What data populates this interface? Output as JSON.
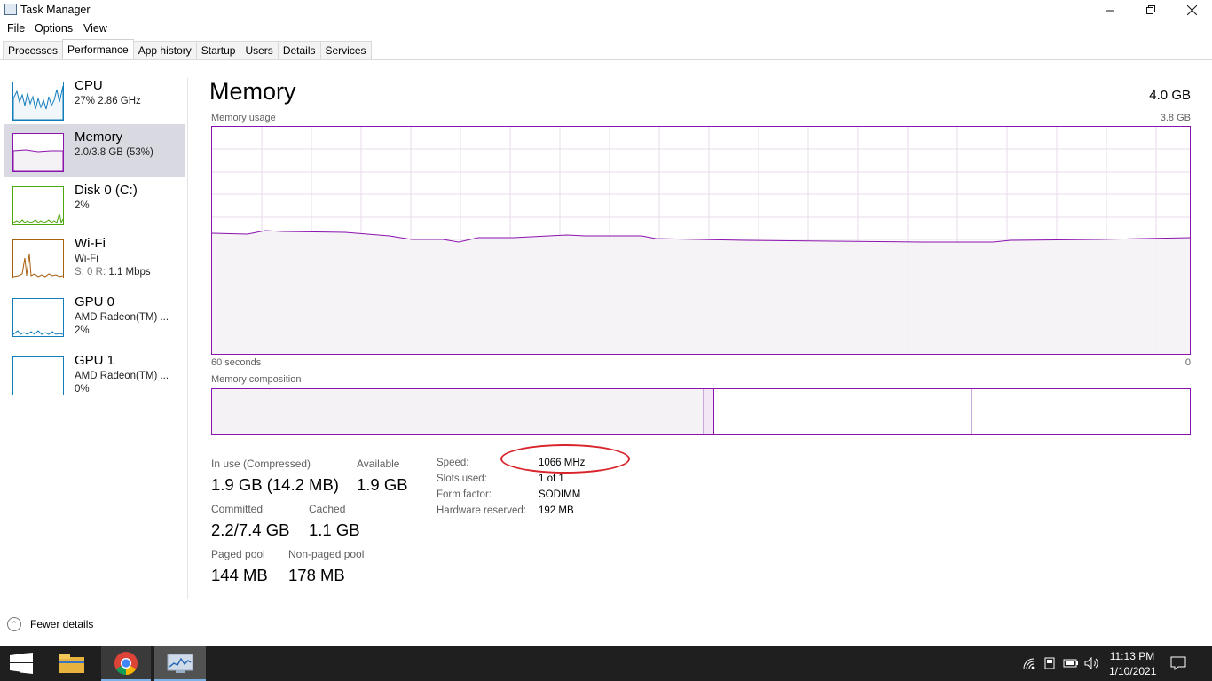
{
  "window": {
    "title": "Task Manager"
  },
  "menu": {
    "file": "File",
    "options": "Options",
    "view": "View"
  },
  "tabs": [
    {
      "label": "Processes"
    },
    {
      "label": "Performance"
    },
    {
      "label": "App history"
    },
    {
      "label": "Startup"
    },
    {
      "label": "Users"
    },
    {
      "label": "Details"
    },
    {
      "label": "Services"
    }
  ],
  "sidebar": {
    "cpu": {
      "title": "CPU",
      "sub": "27%  2.86 GHz",
      "color": "#117dbb"
    },
    "memory": {
      "title": "Memory",
      "sub": "2.0/3.8 GB (53%)",
      "color": "#8b12ae"
    },
    "disk": {
      "title": "Disk 0 (C:)",
      "sub": "2%",
      "color": "#4da60c"
    },
    "wifi": {
      "title": "Wi-Fi",
      "sub1": "Wi-Fi",
      "sub2_label": "S: 0 R: ",
      "sub2_value": "1.1 Mbps",
      "color": "#a75f10"
    },
    "gpu0": {
      "title": "GPU 0",
      "sub1": "AMD Radeon(TM) ...",
      "sub2": "2%",
      "color": "#117dbb"
    },
    "gpu1": {
      "title": "GPU 1",
      "sub1": "AMD Radeon(TM) ...",
      "sub2": "0%",
      "color": "#117dbb"
    }
  },
  "main": {
    "title": "Memory",
    "total": "4.0 GB",
    "usage_label": "Memory usage",
    "usage_max": "3.8 GB",
    "x_left": "60 seconds",
    "x_right": "0",
    "composition_label": "Memory composition"
  },
  "stats": {
    "in_use_label": "In use (Compressed)",
    "in_use_value": "1.9 GB (14.2 MB)",
    "available_label": "Available",
    "available_value": "1.9 GB",
    "committed_label": "Committed",
    "committed_value": "2.2/7.4 GB",
    "cached_label": "Cached",
    "cached_value": "1.1 GB",
    "paged_label": "Paged pool",
    "paged_value": "144 MB",
    "nonpaged_label": "Non-paged pool",
    "nonpaged_value": "178 MB"
  },
  "details": {
    "speed_label": "Speed:",
    "speed_value": "1066 MHz",
    "slots_label": "Slots used:",
    "slots_value": "1 of 1",
    "form_label": "Form factor:",
    "form_value": "SODIMM",
    "reserved_label": "Hardware reserved:",
    "reserved_value": "192 MB"
  },
  "footer": {
    "fewer_details": "Fewer details"
  },
  "taskbar": {
    "time": "11:13 PM",
    "date": "1/10/2021"
  },
  "colors": {
    "memory_accent": "#8b12ae",
    "annotation": "#d8232a",
    "taskbar": "#1f1f1f"
  }
}
